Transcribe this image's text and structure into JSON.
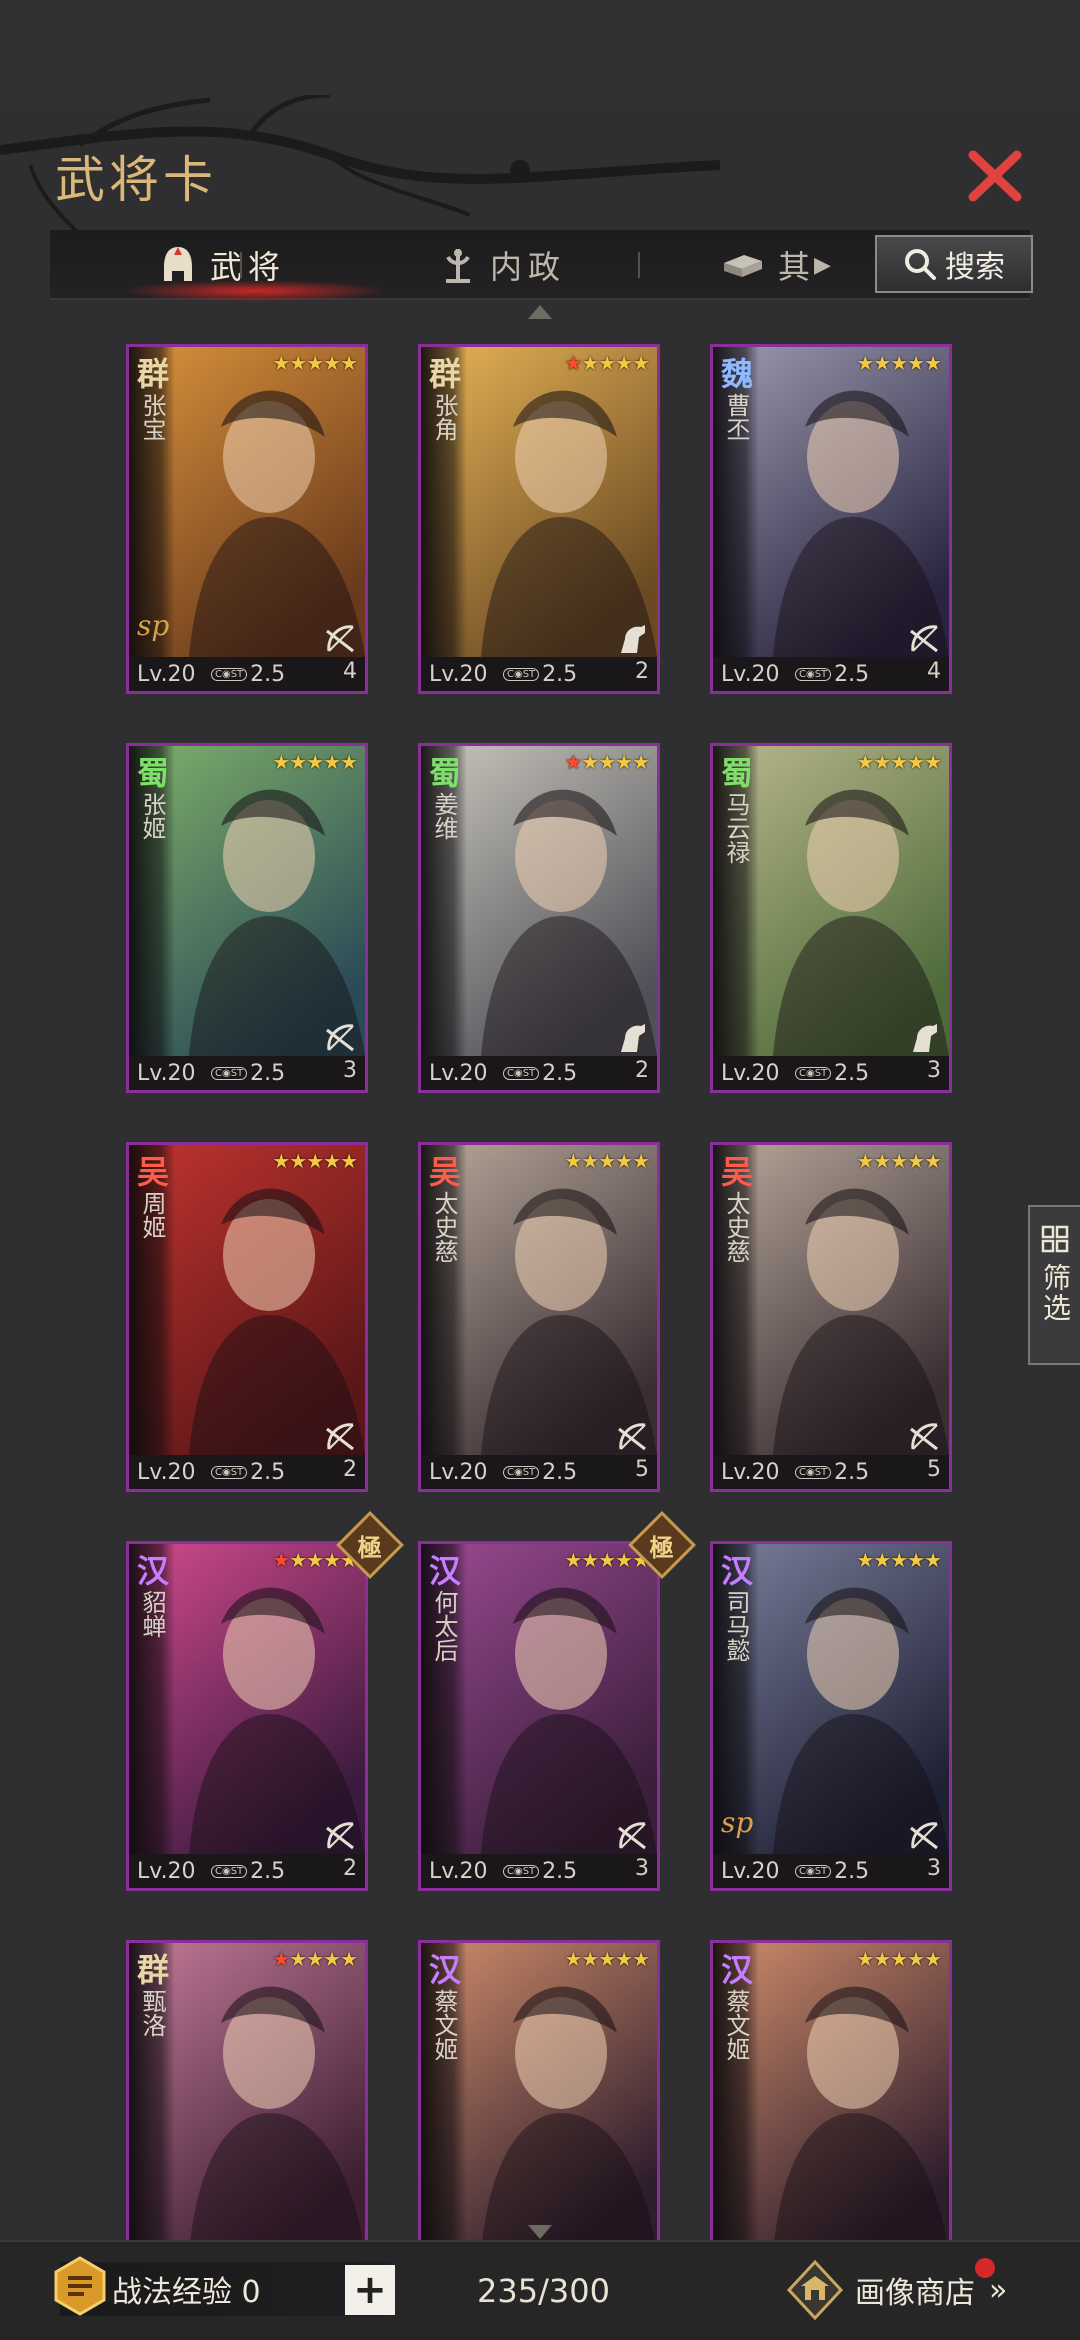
{
  "header": {
    "title": "武将卡",
    "close_icon": "close-icon"
  },
  "tabs": [
    {
      "label": "武将",
      "icon": "helmet-icon",
      "active": true
    },
    {
      "label": "内政",
      "icon": "administration-icon",
      "active": false
    },
    {
      "label": "其",
      "icon": "misc-icon",
      "active": false
    }
  ],
  "search": {
    "label": "搜索"
  },
  "filter": {
    "label": "筛选"
  },
  "cards": [
    {
      "faction": "群",
      "faction_color": "#e8d6a6",
      "name": "张宝",
      "red_stars": 0,
      "stars": 5,
      "level": "Lv.20",
      "cost": "2.5",
      "troop_icon": "bow-icon",
      "troop_count": "4",
      "sp": true,
      "ji": false,
      "palette": [
        "#d9923c",
        "#6a3a1c"
      ]
    },
    {
      "faction": "群",
      "faction_color": "#e8d6a6",
      "name": "张角",
      "red_stars": 1,
      "stars": 5,
      "level": "Lv.20",
      "cost": "2.5",
      "troop_icon": "horse-icon",
      "troop_count": "2",
      "sp": false,
      "ji": false,
      "palette": [
        "#e6b356",
        "#6b4a23"
      ]
    },
    {
      "faction": "魏",
      "faction_color": "#8fb8ff",
      "name": "曹丕",
      "red_stars": 0,
      "stars": 5,
      "level": "Lv.20",
      "cost": "2.5",
      "troop_icon": "bow-icon",
      "troop_count": "4",
      "sp": false,
      "ji": false,
      "palette": [
        "#9c9ab0",
        "#2a2440"
      ]
    },
    {
      "faction": "蜀",
      "faction_color": "#7ee06a",
      "name": "张姬",
      "red_stars": 0,
      "stars": 5,
      "level": "Lv.20",
      "cost": "2.5",
      "troop_icon": "bow-icon",
      "troop_count": "3",
      "sp": false,
      "ji": false,
      "palette": [
        "#7fb06a",
        "#2b4a57"
      ]
    },
    {
      "faction": "蜀",
      "faction_color": "#7ee06a",
      "name": "姜维",
      "red_stars": 1,
      "stars": 5,
      "level": "Lv.20",
      "cost": "2.5",
      "troop_icon": "horse-icon",
      "troop_count": "2",
      "sp": false,
      "ji": false,
      "palette": [
        "#c9c6bc",
        "#505058"
      ]
    },
    {
      "faction": "蜀",
      "faction_color": "#7ee06a",
      "name": "马云禄",
      "red_stars": 0,
      "stars": 5,
      "level": "Lv.20",
      "cost": "2.5",
      "troop_icon": "horse-icon",
      "troop_count": "3",
      "sp": false,
      "ji": false,
      "palette": [
        "#b9b78c",
        "#4e6b3a"
      ]
    },
    {
      "faction": "吴",
      "faction_color": "#ff5a4a",
      "name": "周姬",
      "red_stars": 0,
      "stars": 5,
      "level": "Lv.20",
      "cost": "2.5",
      "troop_icon": "bow-icon",
      "troop_count": "2",
      "sp": false,
      "ji": false,
      "palette": [
        "#c0342e",
        "#5a1618"
      ]
    },
    {
      "faction": "吴",
      "faction_color": "#ff5a4a",
      "name": "太史慈",
      "red_stars": 0,
      "stars": 5,
      "level": "Lv.20",
      "cost": "2.5",
      "troop_icon": "bow-icon",
      "troop_count": "5",
      "sp": false,
      "ji": false,
      "palette": [
        "#b7a79a",
        "#3a2e33"
      ]
    },
    {
      "faction": "吴",
      "faction_color": "#ff5a4a",
      "name": "太史慈",
      "red_stars": 0,
      "stars": 5,
      "level": "Lv.20",
      "cost": "2.5",
      "troop_icon": "bow-icon",
      "troop_count": "5",
      "sp": false,
      "ji": false,
      "palette": [
        "#b7a79a",
        "#3a2e33"
      ]
    },
    {
      "faction": "汉",
      "faction_color": "#c77dff",
      "name": "貂蝉",
      "red_stars": 1,
      "stars": 5,
      "level": "Lv.20",
      "cost": "2.5",
      "troop_icon": "bow-icon",
      "troop_count": "2",
      "sp": false,
      "ji": true,
      "palette": [
        "#d24a8e",
        "#3a1a3e"
      ]
    },
    {
      "faction": "汉",
      "faction_color": "#c77dff",
      "name": "何太后",
      "red_stars": 0,
      "stars": 5,
      "level": "Lv.20",
      "cost": "2.5",
      "troop_icon": "bow-icon",
      "troop_count": "3",
      "sp": false,
      "ji": true,
      "palette": [
        "#9a4a92",
        "#3a1e3a"
      ]
    },
    {
      "faction": "汉",
      "faction_color": "#c77dff",
      "name": "司马懿",
      "red_stars": 0,
      "stars": 5,
      "level": "Lv.20",
      "cost": "2.5",
      "troop_icon": "bow-icon",
      "troop_count": "3",
      "sp": true,
      "ji": false,
      "palette": [
        "#7a7e9a",
        "#1e2034"
      ]
    },
    {
      "faction": "群",
      "faction_color": "#e8d6a6",
      "name": "甄洛",
      "red_stars": 1,
      "stars": 5,
      "level": "",
      "cost": "",
      "troop_icon": "",
      "troop_count": "",
      "sp": false,
      "ji": false,
      "palette": [
        "#c27a98",
        "#3d1e33"
      ]
    },
    {
      "faction": "汉",
      "faction_color": "#c77dff",
      "name": "蔡文姬",
      "red_stars": 0,
      "stars": 5,
      "level": "",
      "cost": "",
      "troop_icon": "",
      "troop_count": "",
      "sp": false,
      "ji": false,
      "palette": [
        "#cf8c6a",
        "#2e1d2d"
      ]
    },
    {
      "faction": "汉",
      "faction_color": "#c77dff",
      "name": "蔡文姬",
      "red_stars": 0,
      "stars": 5,
      "level": "",
      "cost": "",
      "troop_icon": "",
      "troop_count": "",
      "sp": false,
      "ji": false,
      "palette": [
        "#cf8c6a",
        "#2e1d2d"
      ]
    }
  ],
  "bottom": {
    "exp_label": "战法经验 0",
    "plus_label": "+",
    "count": "235/300",
    "shop_label": "画像商店",
    "shop_arrows": "»"
  },
  "colors": {
    "accent": "#d9b879",
    "card_border": "#8a2f9a",
    "close": "#e0433d"
  }
}
